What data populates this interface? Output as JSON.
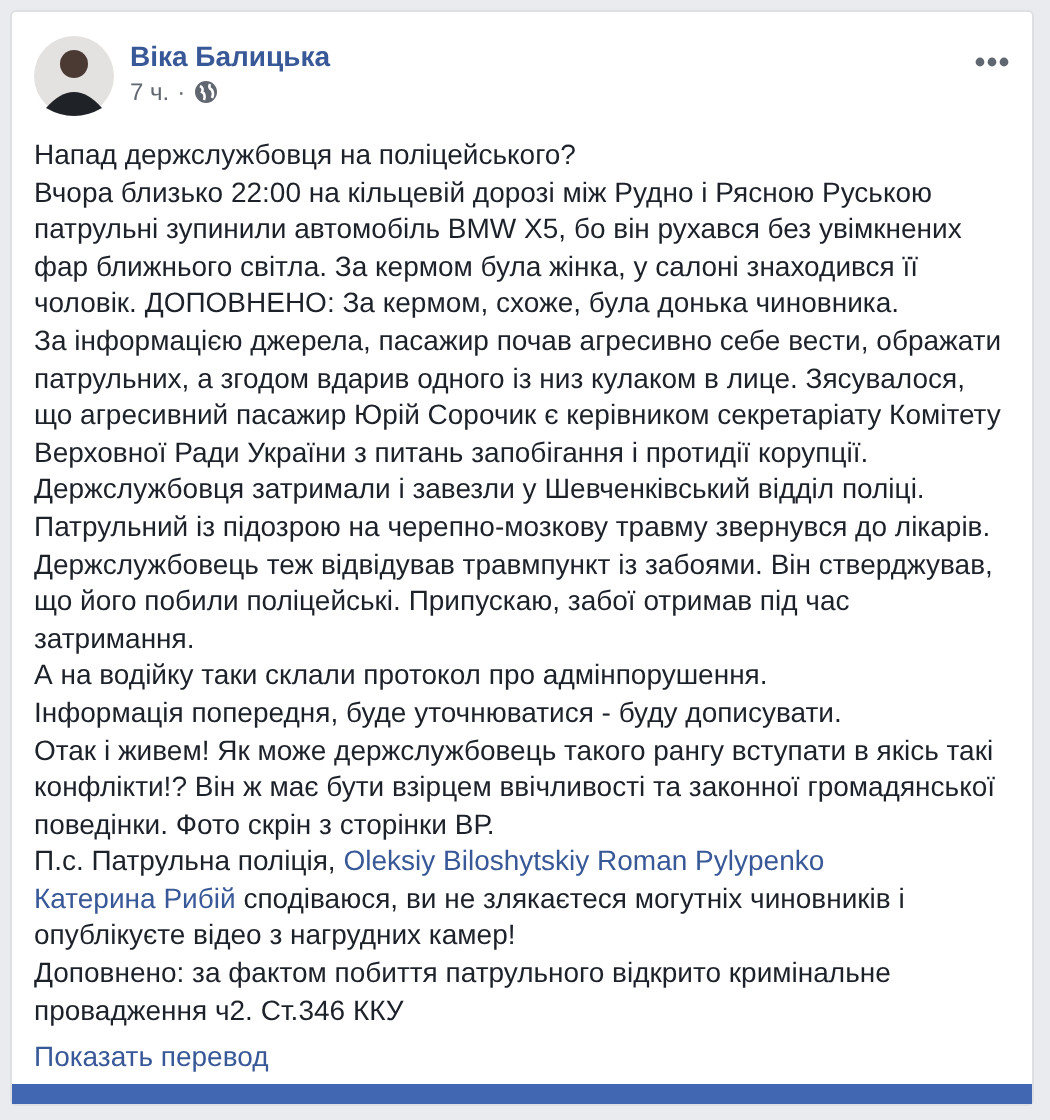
{
  "post": {
    "author": "Віка Балицька",
    "time": "7 ч.",
    "separator": "·",
    "paragraphs": [
      {
        "kind": "text",
        "text": "Напад держслужбовця на поліцейського?"
      },
      {
        "kind": "text",
        "text": "Вчора близько 22:00 на кільцевій дорозі між Рудно і Рясною Руською патрульні зупинили автомобіль BMW X5, бо він рухався без увімкнених фар ближнього світла. За кермом була жінка, у салоні знаходився її чоловік. ДОПОВНЕНО: За кермом, схоже, була донька чиновника."
      },
      {
        "kind": "text",
        "text": "За інформацією джерела, пасажир почав агресивно себе вести, ображати патрульних, а згодом вдарив одного із низ кулаком в лице. Зясувалося, що агресивний пасажир Юрій Сорочик є керівником секретаріату Комітету Верховної Ради України з питань запобігання і протидії корупції."
      },
      {
        "kind": "text",
        "text": "Держслужбовця затримали і завезли у Шевченківський відділ поліці."
      },
      {
        "kind": "text",
        "text": "Патрульний із підозрою на черепно-мозкову травму звернувся до лікарів."
      },
      {
        "kind": "text",
        "text": "Держслужбовець теж відвідував травмпункт із забоями. Він стверджував, що його побили поліцейські. Припускаю, забої отримав під час затримання."
      },
      {
        "kind": "text",
        "text": "А на водійку таки склали протокол про адмінпорушення."
      },
      {
        "kind": "text",
        "text": "Інформація попередня, буде уточнюватися - буду дописувати."
      },
      {
        "kind": "text",
        "text": "Отак і живем! Як може держслужбовець такого рангу вступати в якісь такі конфлікти!? Він ж має бути взірцем ввічливості та законної громадянської поведінки. Фото скрін з сторінки ВР."
      },
      {
        "kind": "mentions",
        "before": "П.с. Патрульна поліція,",
        "mentions": [
          "Oleksiy Biloshytskiy",
          "Roman Pylypenko",
          "Катерина Рибій"
        ],
        "after": "сподіваюся, ви не злякаєтеся могутніх чиновників і опублікуєте відео з нагрудних камер!"
      },
      {
        "kind": "text",
        "text": "Доповнено: за фактом побиття патрульного відкрито кримінальне провадження ч2. Ст.346 ККУ"
      }
    ],
    "translate_link": "Показать перевод"
  }
}
